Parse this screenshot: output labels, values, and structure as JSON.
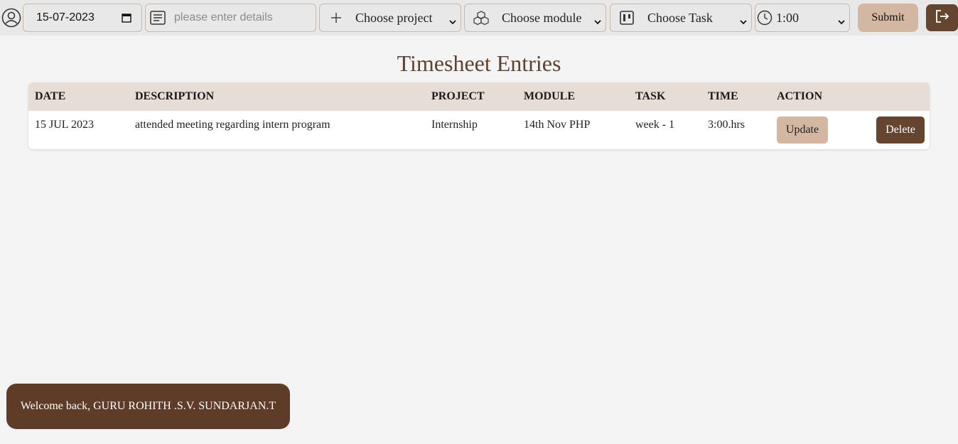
{
  "toolbar": {
    "date_value": "15-07-2023",
    "details_placeholder": "please enter details",
    "project_label": "Choose project",
    "module_label": "Choose module",
    "task_label": "Choose Task",
    "time_value": "1:00",
    "submit_label": "Submit"
  },
  "main": {
    "title": "Timesheet Entries",
    "table": {
      "headers": [
        "DATE",
        "DESCRIPTION",
        "PROJECT",
        "MODULE",
        "TASK",
        "TIME",
        "ACTION"
      ],
      "rows": [
        {
          "date": "15 JUL 2023",
          "description": "attended meeting regarding intern program",
          "project": "Internship",
          "module": "14th Nov PHP",
          "task": "week - 1",
          "time": "3:00.hrs",
          "update_label": "Update",
          "delete_label": "Delete"
        }
      ]
    }
  },
  "toast": {
    "message": "Welcome back, GURU ROHITH .S.V. SUNDARJAN.T"
  },
  "colors": {
    "accent_light": "#d4b7a2",
    "accent_dark": "#64452f",
    "header_bg": "#e6ddd7",
    "title": "#5e4232"
  },
  "icons": [
    "user-icon",
    "calendar-icon",
    "details-icon",
    "plus-icon",
    "cubes-icon",
    "kanban-icon",
    "clock-icon",
    "chevron-down-icon",
    "logout-icon"
  ]
}
